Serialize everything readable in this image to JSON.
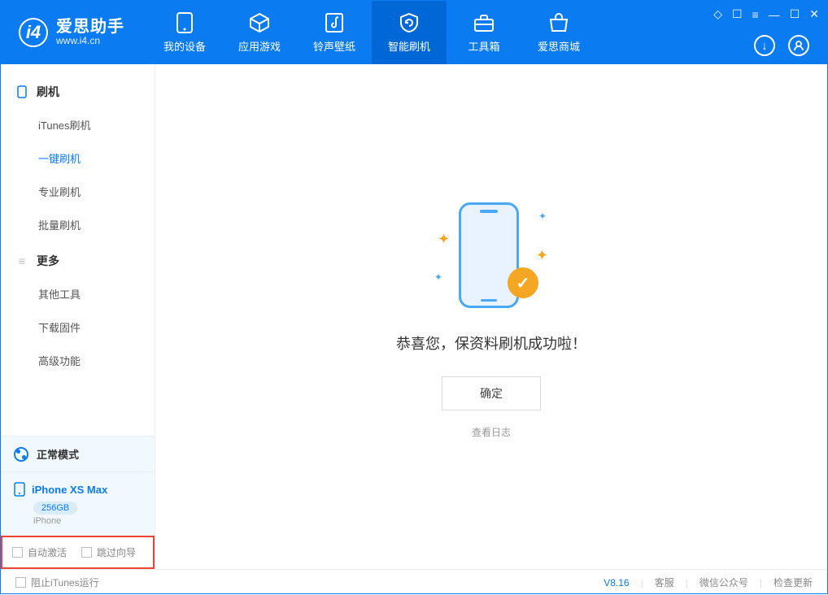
{
  "app": {
    "title": "爱思助手",
    "subtitle": "www.i4.cn"
  },
  "nav": {
    "items": [
      {
        "label": "我的设备"
      },
      {
        "label": "应用游戏"
      },
      {
        "label": "铃声壁纸"
      },
      {
        "label": "智能刷机"
      },
      {
        "label": "工具箱"
      },
      {
        "label": "爱思商城"
      }
    ],
    "active_index": 3
  },
  "sidebar": {
    "cat1": "刷机",
    "items1": [
      "iTunes刷机",
      "一键刷机",
      "专业刷机",
      "批量刷机"
    ],
    "active1_index": 1,
    "cat2": "更多",
    "items2": [
      "其他工具",
      "下载固件",
      "高级功能"
    ],
    "mode_label": "正常模式",
    "device": {
      "name": "iPhone XS Max",
      "capacity": "256GB",
      "type": "iPhone"
    },
    "options": {
      "auto_activate": "自动激活",
      "skip_guide": "跳过向导"
    }
  },
  "main": {
    "success_message": "恭喜您，保资料刷机成功啦！",
    "ok_button": "确定",
    "view_log": "查看日志"
  },
  "statusbar": {
    "block_itunes": "阻止iTunes运行",
    "version": "V8.16",
    "support": "客服",
    "wechat": "微信公众号",
    "check_update": "检查更新"
  }
}
